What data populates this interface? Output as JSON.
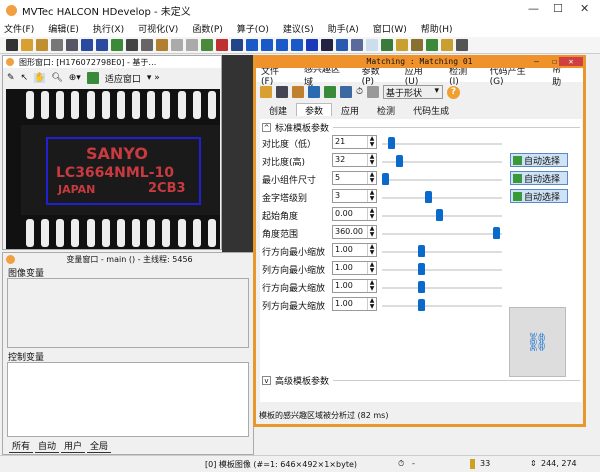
{
  "app": {
    "title": "MVTec HALCON HDevelop - 未定义"
  },
  "menu": [
    "文件(F)",
    "编辑(E)",
    "执行(X)",
    "可视化(V)",
    "函数(P)",
    "算子(O)",
    "建议(S)",
    "助手(A)",
    "窗口(W)",
    "帮助(H)"
  ],
  "graphics_window": {
    "title": "图形窗口: [H176072798E0] - 基于…",
    "fit_label": "适应窗口",
    "image_text": {
      "brand": "SANYO",
      "part": "LC3664NML-10",
      "origin": "JAPAN",
      "code": "2CB3"
    }
  },
  "dialog": {
    "title": "Matching : Matching 01",
    "menu": [
      "文件(F)",
      "感兴趣区域",
      "参数(P)",
      "应用(U)",
      "检测(I)",
      "代码产生(G)",
      "帮助"
    ],
    "method_select": "基于形状",
    "tabs": [
      "创建",
      "参数",
      "应用",
      "检测",
      "代码生成"
    ],
    "active_tab": "参数",
    "section_standard": "标准模板参数",
    "section_advanced": "高级模板参数",
    "auto_label": "自动选择",
    "params": [
      {
        "label": "对比度（低）",
        "value": "21",
        "pos": 0.05,
        "auto": false
      },
      {
        "label": "对比度(高)",
        "value": "32",
        "pos": 0.12,
        "auto": true
      },
      {
        "label": "最小组件尺寸",
        "value": "5",
        "pos": 0.0,
        "auto": true
      },
      {
        "label": "金字塔级别",
        "value": "3",
        "pos": 0.38,
        "auto": true
      },
      {
        "label": "起始角度",
        "value": "0.00",
        "pos": 0.48,
        "auto": false
      },
      {
        "label": "角度范围",
        "value": "360.00",
        "pos": 0.98,
        "auto": false
      },
      {
        "label": "行方向最小缩放",
        "value": "1.00",
        "pos": 0.32,
        "auto": false
      },
      {
        "label": "列方向最小缩放",
        "value": "1.00",
        "pos": 0.32,
        "auto": false
      },
      {
        "label": "行方向最大缩放",
        "value": "1.00",
        "pos": 0.32,
        "auto": false
      },
      {
        "label": "列方向最大缩放",
        "value": "1.00",
        "pos": 0.32,
        "auto": false
      }
    ],
    "status": "模板的感兴趣区域被分析过 (82 ms)"
  },
  "variable_window": {
    "title": "变量窗口 - main () - 主线程: 5456",
    "image_vars": "图像变量",
    "control_vars": "控制变量",
    "tabs": [
      "所有",
      "自动",
      "用户",
      "全局"
    ]
  },
  "statusbar": {
    "image_info": "[0] 模板图像 (#=1: 646×492×1×byte)",
    "timer": "-",
    "gray": "33",
    "coords": "244, 274"
  },
  "colors": {
    "accent": "#f0922b",
    "thumb": "#0a6acc",
    "roi": "#2020d0"
  }
}
